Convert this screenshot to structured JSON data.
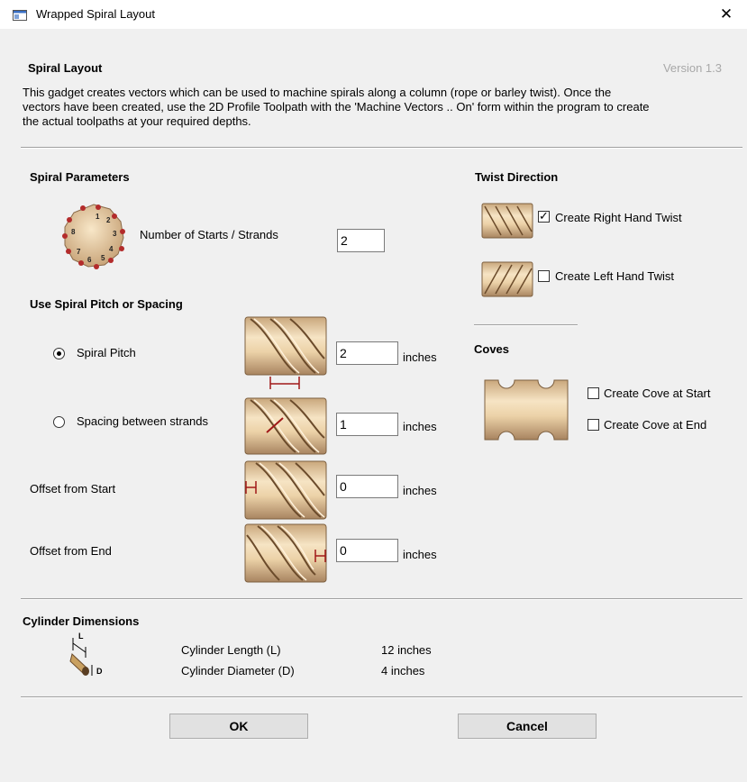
{
  "window": {
    "title": "Wrapped Spiral Layout",
    "close_glyph": "✕"
  },
  "header": {
    "title": "Spiral Layout",
    "version": "Version 1.3",
    "description_lines": [
      "This gadget creates vectors which can be used to machine spirals along a column (rope or barley twist). Once the",
      "vectors have been created, use the 2D Profile Toolpath with the 'Machine Vectors .. On' form within the program to create",
      "the actual toolpaths at your required depths."
    ]
  },
  "spiral_parameters": {
    "heading": "Spiral Parameters",
    "starts_label": "Number of Starts / Strands",
    "starts_value": "2"
  },
  "pitch_spacing": {
    "heading": "Use Spiral Pitch or Spacing",
    "pitch_label": "Spiral Pitch",
    "pitch_value": "2",
    "pitch_selected": true,
    "spacing_label": "Spacing between strands",
    "spacing_value": "1",
    "offset_start_label": "Offset from Start",
    "offset_start_value": "0",
    "offset_end_label": "Offset from End",
    "offset_end_value": "0",
    "unit": "inches"
  },
  "twist": {
    "heading": "Twist Direction",
    "right_label": "Create Right Hand Twist",
    "right_checked": true,
    "left_label": "Create Left Hand Twist",
    "left_checked": false
  },
  "coves": {
    "heading": "Coves",
    "start_label": "Create Cove at Start",
    "end_label": "Create Cove at End"
  },
  "cylinder": {
    "heading": "Cylinder Dimensions",
    "length_label": "Cylinder Length (L)",
    "length_value": "12  inches",
    "diameter_label": "Cylinder Diameter (D)",
    "diameter_value": "4  inches",
    "icon_L": "L",
    "icon_D": "D"
  },
  "buttons": {
    "ok": "OK",
    "cancel": "Cancel"
  },
  "starts_diagram_numbers": [
    "1",
    "2",
    "3",
    "4",
    "5",
    "6",
    "7",
    "8"
  ],
  "colors": {
    "wood_light": "#f2dcb8",
    "wood_dark": "#b89770",
    "marker": "#c0392b",
    "dim_line": "#a01818"
  }
}
